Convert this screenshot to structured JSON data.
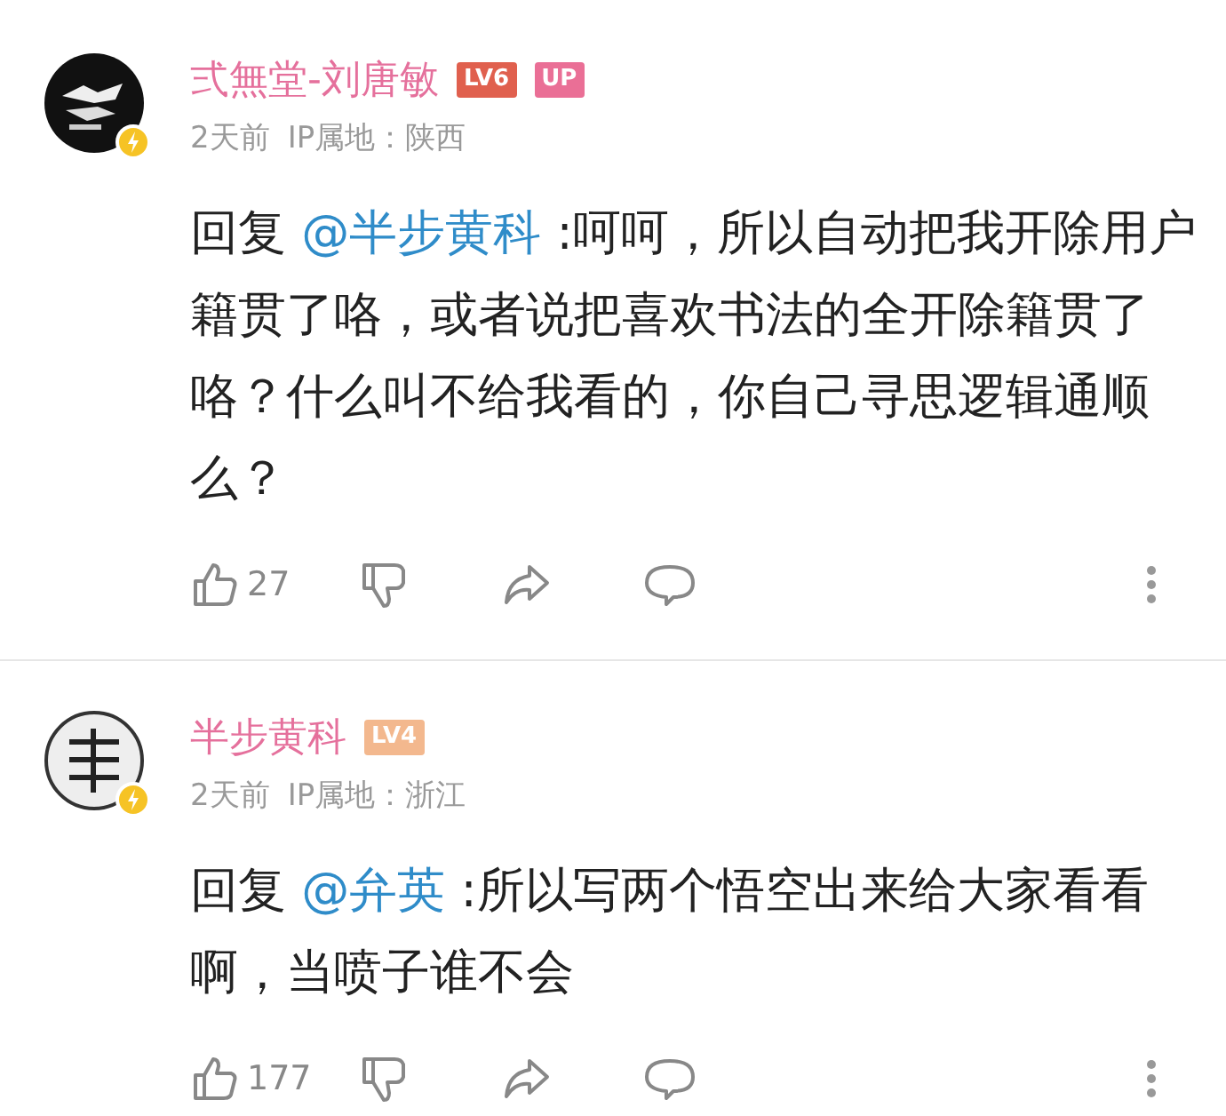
{
  "comments": [
    {
      "user": {
        "name": "弍無堂-刘唐敏",
        "badges": [
          {
            "text": "LV6",
            "color": "#e0604e"
          },
          {
            "text": "UP",
            "color": "#ea6f96"
          }
        ]
      },
      "time": "2天前",
      "ip_label": "IP属地：",
      "ip": "陕西",
      "reply_prefix": "回复",
      "mention": "@半步黄科",
      "text": ":呵呵，所以自动把我开除用户籍贯了咯，或者说把喜欢书法的全开除籍贯了咯？什么叫不给我看的，你自己寻思逻辑通顺么？",
      "likes": "27"
    },
    {
      "user": {
        "name": "半步黄科",
        "badges": [
          {
            "text": "LV4",
            "color": "#f3b88e"
          }
        ]
      },
      "time": "2天前",
      "ip_label": "IP属地：",
      "ip": "浙江",
      "reply_prefix": "回复",
      "mention": "@弁英",
      "text": ":所以写两个悟空出来给大家看看啊，当喷子谁不会",
      "likes": "177"
    }
  ]
}
